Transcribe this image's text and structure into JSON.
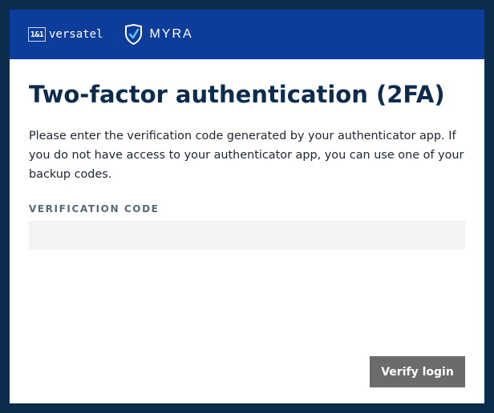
{
  "header": {
    "brand_1and1_mark": "1&1",
    "brand_1and1_word": "versatel",
    "brand_myra_word": "MYRA"
  },
  "main": {
    "title": "Two-factor authentication (2FA)",
    "description": "Please enter the verification code generated by your authenticator app. If you do not have access to your authenticator app, you can use one of your backup codes.",
    "field_label": "VERIFICATION CODE",
    "field_value": "",
    "verify_label": "Verify login"
  },
  "icons": {
    "myra_logo": "shield-check-icon"
  },
  "colors": {
    "page_background": "#0c2c4d",
    "header_background": "#0c3d9c",
    "title_color": "#0c2c4d",
    "input_background": "#f2f3f5",
    "button_background": "#6b6b6b"
  }
}
